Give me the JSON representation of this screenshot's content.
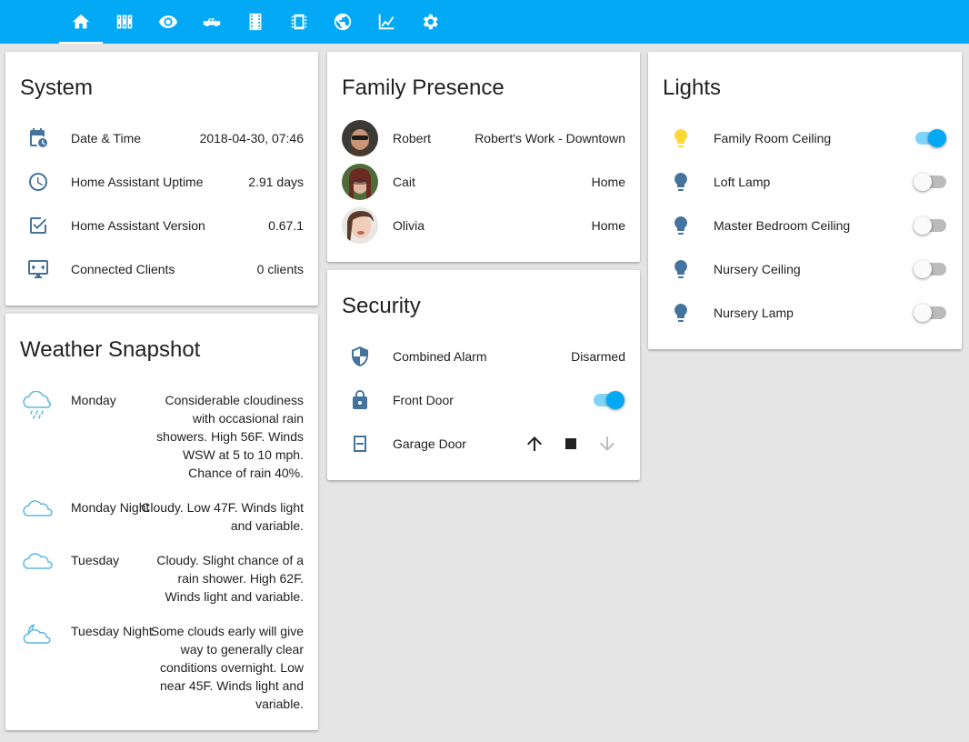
{
  "colors": {
    "accent": "#03a9f4",
    "icon": "#44739e",
    "light_on": "#fdd835",
    "background": "#e5e5e5"
  },
  "tabs": [
    {
      "icon": "home-icon",
      "active": true
    },
    {
      "icon": "library-icon",
      "active": false
    },
    {
      "icon": "eye-icon",
      "active": false
    },
    {
      "icon": "car-icon",
      "active": false
    },
    {
      "icon": "film-icon",
      "active": false
    },
    {
      "icon": "chip-icon",
      "active": false
    },
    {
      "icon": "globe-icon",
      "active": false
    },
    {
      "icon": "chart-icon",
      "active": false
    },
    {
      "icon": "gear-icon",
      "active": false
    }
  ],
  "system": {
    "title": "System",
    "rows": [
      {
        "icon": "calendar-clock-icon",
        "label": "Date & Time",
        "value": "2018-04-30, 07:46"
      },
      {
        "icon": "clock-icon",
        "label": "Home Assistant Uptime",
        "value": "2.91 days"
      },
      {
        "icon": "checkbox-icon",
        "label": "Home Assistant Version",
        "value": "0.67.1"
      },
      {
        "icon": "monitor-icon",
        "label": "Connected Clients",
        "value": "0 clients"
      }
    ]
  },
  "weather": {
    "title": "Weather Snapshot",
    "rows": [
      {
        "icon": "rain-cloud-icon",
        "day": "Monday",
        "text": "Considerable cloudiness with occasional rain showers. High 56F. Winds WSW at 5 to 10 mph. Chance of rain 40%."
      },
      {
        "icon": "cloud-icon",
        "day": "Monday Night",
        "text": "Cloudy. Low 47F. Winds light and variable."
      },
      {
        "icon": "cloud-icon",
        "day": "Tuesday",
        "text": "Cloudy. Slight chance of a rain shower. High 62F. Winds light and variable."
      },
      {
        "icon": "moon-cloud-icon",
        "day": "Tuesday Night",
        "text": "Some clouds early will give way to generally clear conditions overnight. Low near 45F. Winds light and variable."
      }
    ]
  },
  "presence": {
    "title": "Family Presence",
    "rows": [
      {
        "name": "Robert",
        "state": "Robert's Work - Downtown"
      },
      {
        "name": "Cait",
        "state": "Home"
      },
      {
        "name": "Olivia",
        "state": "Home"
      }
    ]
  },
  "security": {
    "title": "Security",
    "alarm": {
      "icon": "shield-icon",
      "label": "Combined Alarm",
      "state": "Disarmed"
    },
    "lock": {
      "icon": "lock-icon",
      "label": "Front Door",
      "on": true
    },
    "garage": {
      "icon": "garage-icon",
      "label": "Garage Door"
    }
  },
  "lights": {
    "title": "Lights",
    "rows": [
      {
        "label": "Family Room Ceiling",
        "on": true
      },
      {
        "label": "Loft Lamp",
        "on": false
      },
      {
        "label": "Master Bedroom Ceiling",
        "on": false
      },
      {
        "label": "Nursery Ceiling",
        "on": false
      },
      {
        "label": "Nursery Lamp",
        "on": false
      }
    ]
  }
}
